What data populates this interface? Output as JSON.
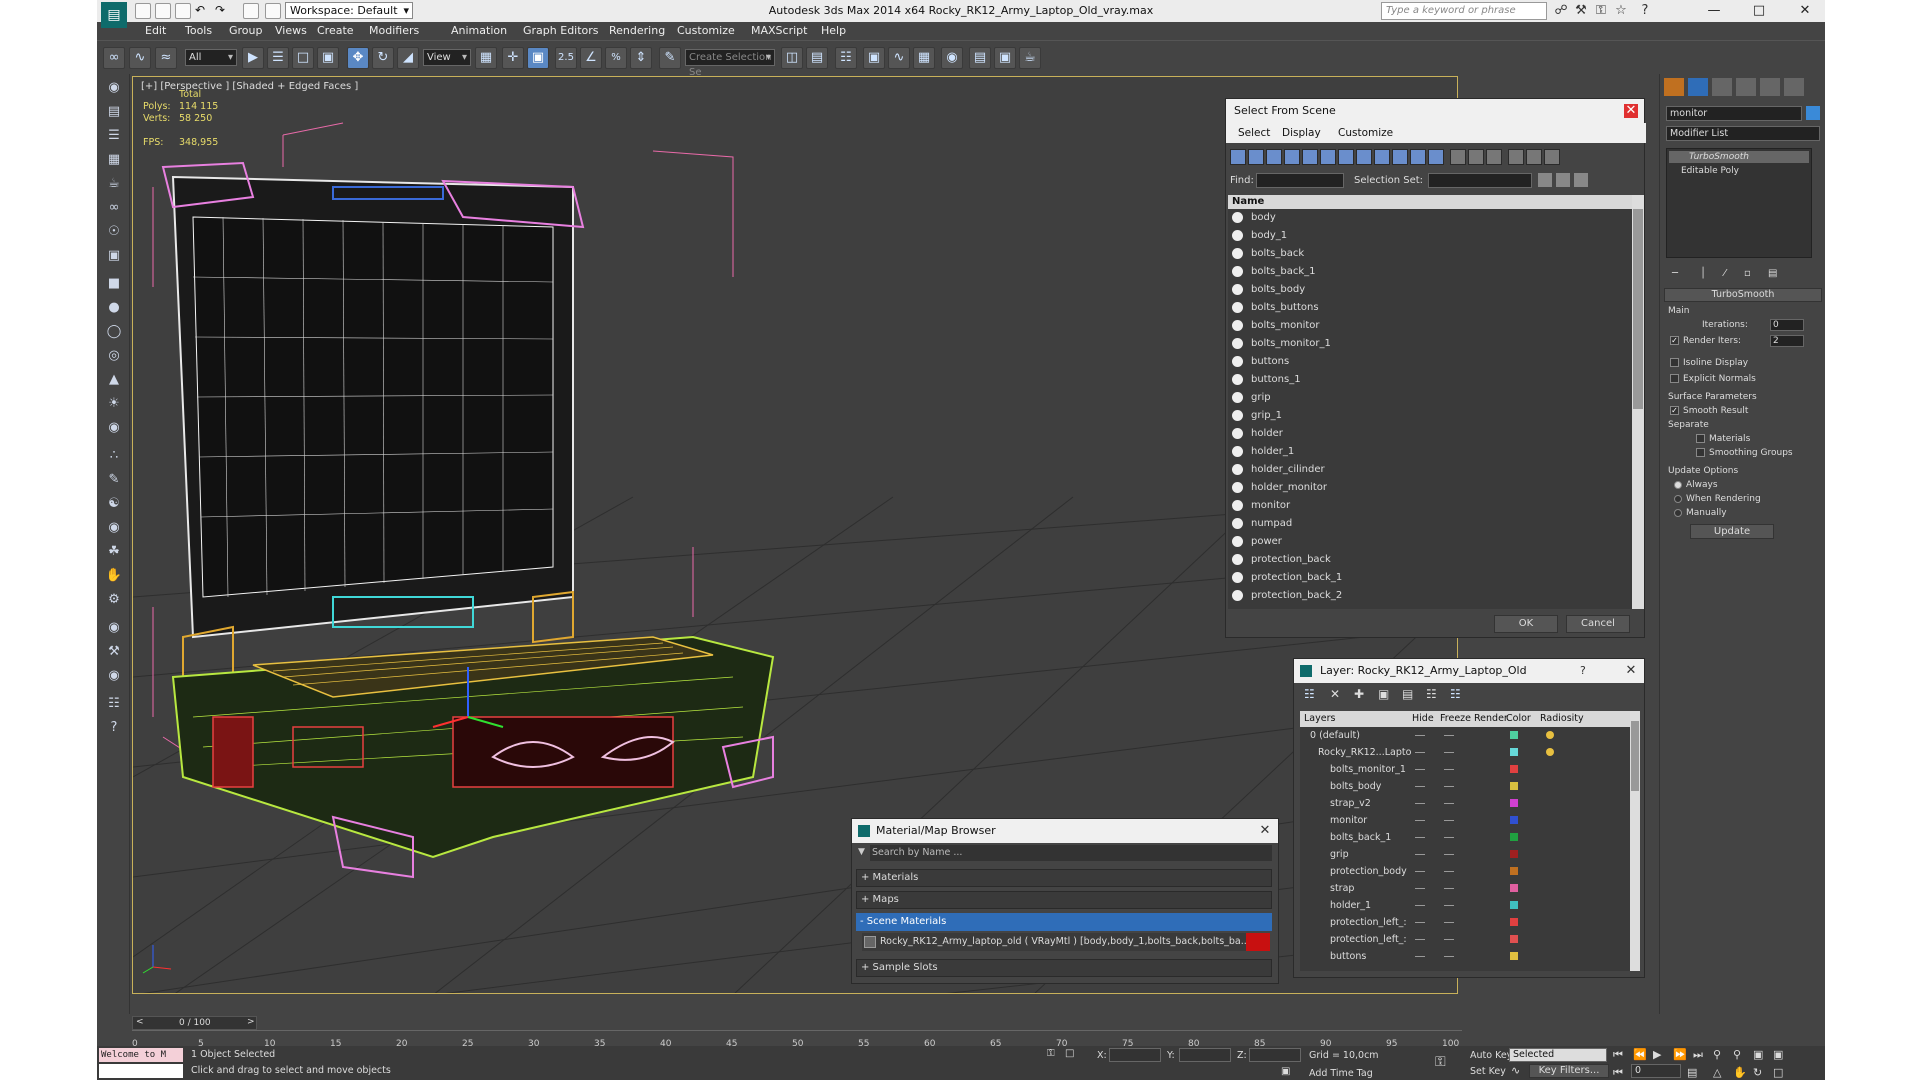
{
  "titlebar": {
    "workspace": "Workspace: Default",
    "window_title": "Autodesk 3ds Max  2014 x64      Rocky_RK12_Army_Laptop_Old_vray.max",
    "search_placeholder": "Type a keyword or phrase"
  },
  "menus": [
    "Edit",
    "Tools",
    "Group",
    "Views",
    "Create",
    "Modifiers",
    "Animation",
    "Graph Editors",
    "Rendering",
    "Customize",
    "MAXScript",
    "Help"
  ],
  "toolbar": {
    "selection_filter": "All",
    "ref_coord": "View",
    "snap_value": "2.5",
    "named_selection_placeholder": "Create Selection Se"
  },
  "viewport": {
    "label": "[+] [Perspective ] [Shaded + Edged Faces ]",
    "stats_total": "Total",
    "polys_label": "Polys:",
    "polys_value": "114 115",
    "verts_label": "Verts:",
    "verts_value": "58 250",
    "fps_label": "FPS:",
    "fps_value": "348,955"
  },
  "select_from_scene": {
    "title": "Select From Scene",
    "menus": [
      "Select",
      "Display",
      "Customize"
    ],
    "find_label": "Find:",
    "selection_set_label": "Selection Set:",
    "column_name": "Name",
    "items": [
      "body",
      "body_1",
      "bolts_back",
      "bolts_back_1",
      "bolts_body",
      "bolts_buttons",
      "bolts_monitor",
      "bolts_monitor_1",
      "buttons",
      "buttons_1",
      "grip",
      "grip_1",
      "holder",
      "holder_1",
      "holder_cilinder",
      "holder_monitor",
      "monitor",
      "numpad",
      "power",
      "protection_back",
      "protection_back_1",
      "protection_back_2"
    ],
    "ok": "OK",
    "cancel": "Cancel"
  },
  "layer_dialog": {
    "title": "Layer: Rocky_RK12_Army_Laptop_Old",
    "help": "?",
    "columns": [
      "Layers",
      "Hide",
      "Freeze",
      "Render",
      "Color",
      "Radiosity"
    ],
    "rows": [
      {
        "name": "0 (default)",
        "color": "#4fd0a0"
      },
      {
        "name": "Rocky_RK12...Lapto",
        "color": "#66d8d8"
      },
      {
        "name": "bolts_monitor_1",
        "color": "#e04040"
      },
      {
        "name": "bolts_body",
        "color": "#d8c040"
      },
      {
        "name": "strap_v2",
        "color": "#d040d0"
      },
      {
        "name": "monitor",
        "color": "#3050d0"
      },
      {
        "name": "bolts_back_1",
        "color": "#20a040"
      },
      {
        "name": "grip",
        "color": "#a02020"
      },
      {
        "name": "protection_body",
        "color": "#c07020"
      },
      {
        "name": "strap",
        "color": "#e060a0"
      },
      {
        "name": "holder_1",
        "color": "#40c0c0"
      },
      {
        "name": "protection_left_:",
        "color": "#e04040"
      },
      {
        "name": "protection_left_:",
        "color": "#e05050"
      },
      {
        "name": "buttons",
        "color": "#e0c040"
      }
    ]
  },
  "material_browser": {
    "title": "Material/Map Browser",
    "search_placeholder": "Search by Name ...",
    "groups": [
      "+ Materials",
      "+ Maps",
      "- Scene Materials",
      "+ Sample Slots"
    ],
    "scene_material": "Rocky_RK12_Army_laptop_old ( VRayMtl ) [body,body_1,bolts_back,bolts_ba..."
  },
  "command_panel": {
    "object_name": "monitor",
    "modifier_list": "Modifier List",
    "stack": [
      "TurboSmooth",
      "Editable Poly"
    ],
    "rollout_title": "TurboSmooth",
    "main_label": "Main",
    "iterations_label": "Iterations:",
    "iterations_value": "0",
    "render_iters_label": "Render Iters:",
    "render_iters_value": "2",
    "isoline": "Isoline Display",
    "explicit_normals": "Explicit Normals",
    "surface_params": "Surface Parameters",
    "smooth_result": "Smooth Result",
    "separate": "Separate",
    "materials": "Materials",
    "smoothing_groups": "Smoothing Groups",
    "update_options": "Update Options",
    "always": "Always",
    "when_rendering": "When Rendering",
    "manually": "Manually",
    "update_button": "Update"
  },
  "timeline": {
    "frame_counter": "0 / 100",
    "ticks": [
      "0",
      "5",
      "10",
      "15",
      "20",
      "25",
      "30",
      "35",
      "40",
      "45",
      "50",
      "55",
      "60",
      "65",
      "70",
      "75",
      "80",
      "85",
      "90",
      "95",
      "100"
    ]
  },
  "status": {
    "maxscript": "Welcome to M",
    "selected": "1 Object Selected",
    "prompt": "Click and drag to select and move objects",
    "x_label": "X:",
    "y_label": "Y:",
    "z_label": "Z:",
    "grid": "Grid = 10,0cm",
    "add_time_tag": "Add Time Tag",
    "auto_key": "Auto Key",
    "set_key": "Set Key",
    "key_mode": "Selected",
    "key_filters": "Key Filters...",
    "frame": "0"
  }
}
